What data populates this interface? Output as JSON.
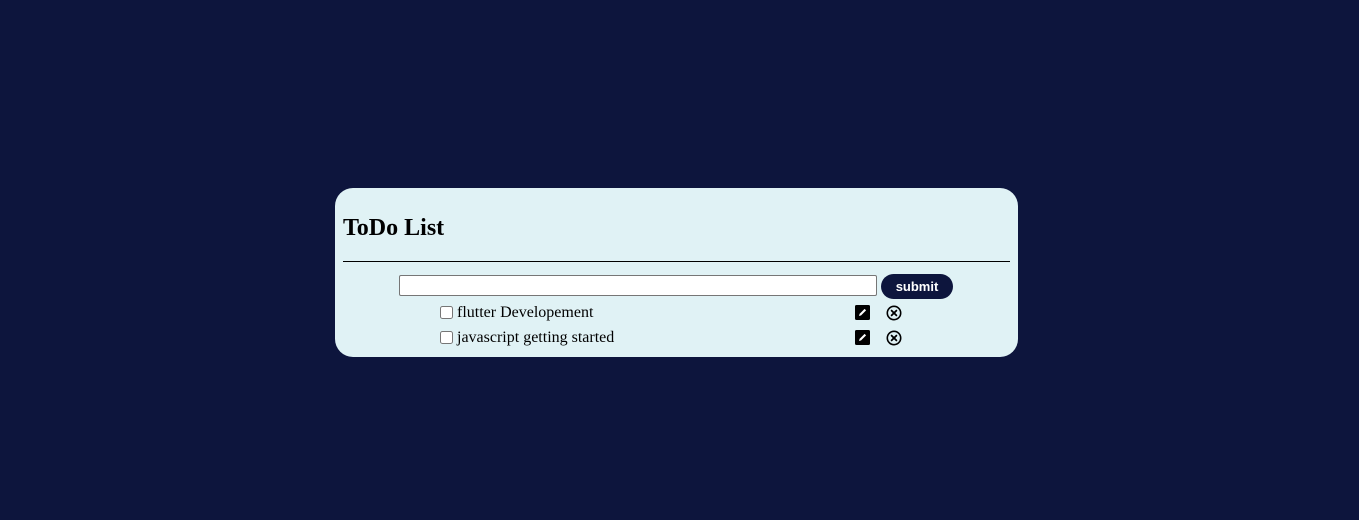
{
  "app": {
    "title": "ToDo List"
  },
  "form": {
    "input_value": "",
    "input_placeholder": "",
    "submit_label": "submit"
  },
  "todos": [
    {
      "text": "flutter Developement",
      "checked": false
    },
    {
      "text": "javascript getting started",
      "checked": false
    }
  ],
  "icons": {
    "edit": "edit-pencil-icon",
    "delete": "circle-x-icon"
  },
  "colors": {
    "background": "#0d153d",
    "card": "#e0f2f5",
    "button": "#0d153d",
    "button_text": "#ffffff"
  }
}
